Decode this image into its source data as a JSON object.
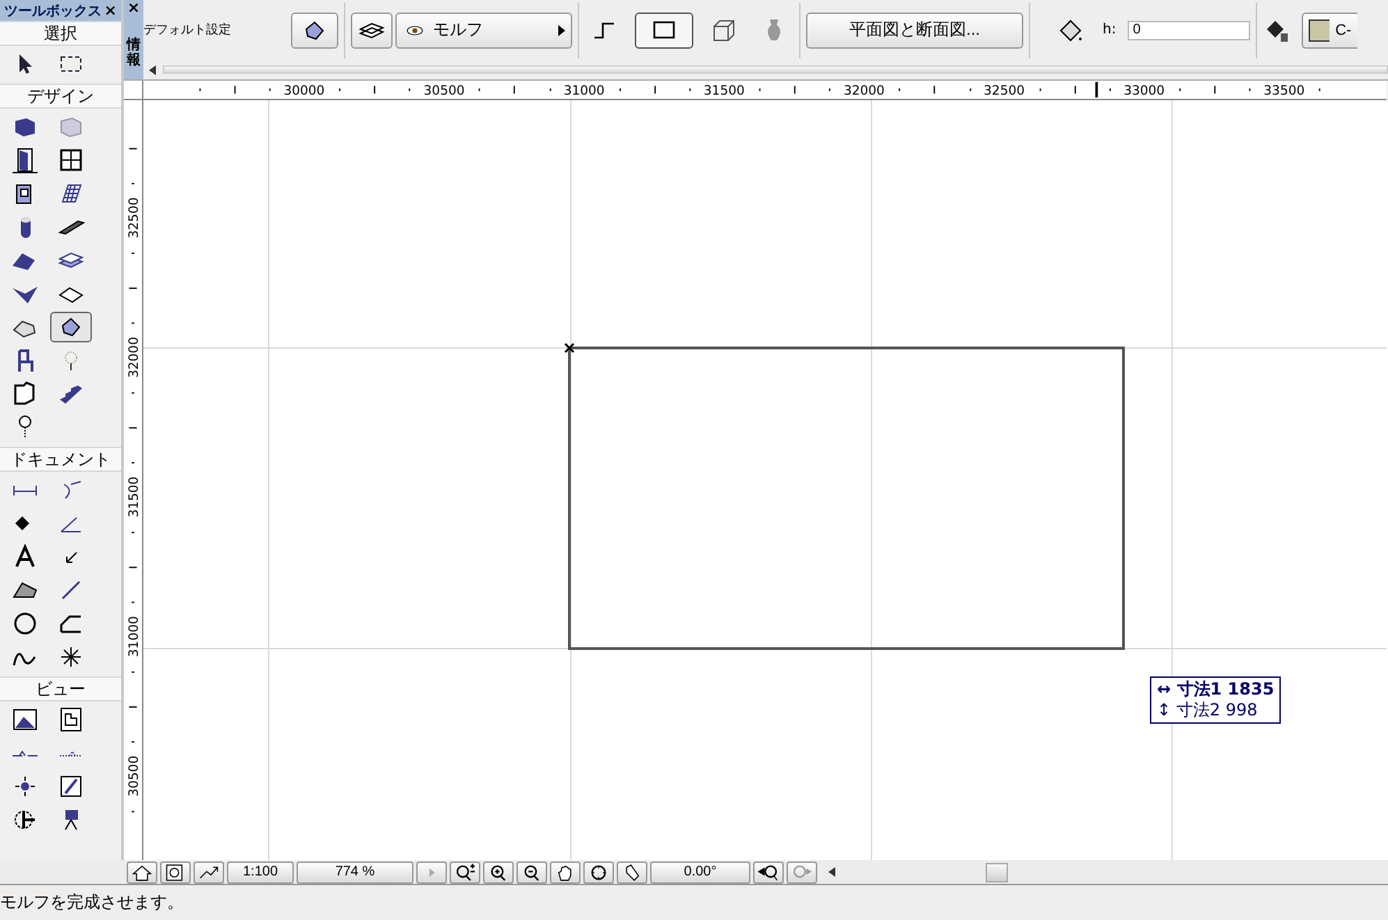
{
  "toolbox": {
    "title": "ツールボックス",
    "close": "×",
    "sections": [
      {
        "title": "選択",
        "tools": [
          {
            "selected": false
          },
          {
            "selected": false
          }
        ]
      },
      {
        "title": "デザイン",
        "tools": [
          {
            "selected": false
          },
          {
            "selected": false
          },
          {
            "selected": false
          },
          {
            "selected": false
          },
          {
            "selected": false
          },
          {
            "selected": false
          },
          {
            "selected": false
          },
          {
            "selected": false
          },
          {
            "selected": false
          },
          {
            "selected": false
          },
          {
            "selected": false
          },
          {
            "selected": false
          },
          {
            "selected": false
          },
          {
            "selected": true
          },
          {
            "selected": false
          },
          {
            "selected": false
          },
          {
            "selected": false
          },
          {
            "selected": false
          },
          {
            "selected": false
          }
        ]
      },
      {
        "title": "ドキュメント",
        "tools": [
          {
            "selected": false
          },
          {
            "selected": false
          },
          {
            "selected": false
          },
          {
            "selected": false
          },
          {
            "selected": false
          },
          {
            "selected": false
          },
          {
            "selected": false
          },
          {
            "selected": false
          },
          {
            "selected": false
          },
          {
            "selected": false
          },
          {
            "selected": false
          },
          {
            "selected": false
          }
        ]
      },
      {
        "title": "ビュー",
        "tools": [
          {
            "selected": false
          },
          {
            "selected": false
          },
          {
            "selected": false
          },
          {
            "selected": false
          },
          {
            "selected": false
          },
          {
            "selected": false
          },
          {
            "selected": false
          },
          {
            "selected": false
          }
        ]
      }
    ]
  },
  "info_box": {
    "close": "×",
    "side_label": "情報",
    "default_label": "デフォルト設定",
    "layer_dropdown": "モルフ",
    "geometry_methods": [
      {
        "selected": false
      },
      {
        "selected": true
      },
      {
        "selected": false
      },
      {
        "selected": false
      }
    ],
    "plan_section_button": "平面図と断面図...",
    "height_label": "h:",
    "height_value": "0",
    "surface_label": "C-"
  },
  "rulers": {
    "horizontal": [
      "30000",
      "30500",
      "31000",
      "31500",
      "32000",
      "32500",
      "33000",
      "33500"
    ],
    "vertical": [
      "32500",
      "32000",
      "31500",
      "31000",
      "30500"
    ]
  },
  "dimension_tooltip": [
    {
      "symbol": "↔",
      "label": "寸法1",
      "value": "1835",
      "selected": true
    },
    {
      "symbol": "↕",
      "label": "寸法2",
      "value": "998",
      "selected": false
    }
  ],
  "bottom_bar": {
    "scale": "1:100",
    "zoom": "774 %",
    "angle": "0.00°"
  },
  "status_bar": "モルフを完成させます。"
}
